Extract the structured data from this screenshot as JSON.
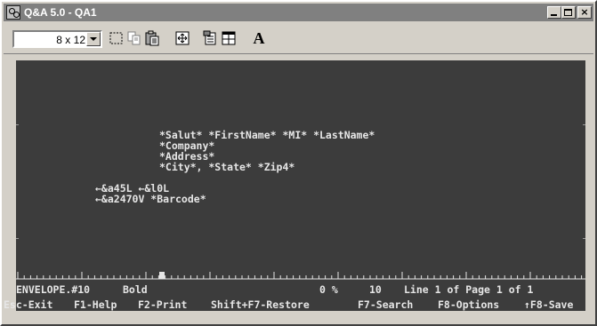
{
  "window": {
    "title": "Q&A 5.0 - QA1",
    "controls": {
      "minimize": "_",
      "maximize": "□",
      "close": "×"
    }
  },
  "toolbar": {
    "font_size_value": "8 x 12",
    "icons": [
      "select-icon",
      "copy-icon",
      "paste-icon",
      "fullscreen-icon",
      "properties-icon",
      "window-icon",
      "font-icon"
    ],
    "font_button_label": "A"
  },
  "document": {
    "lines": [
      "*Salut* *FirstName* *MI* *LastName*",
      "*Company*",
      "*Address*",
      "*City*, *State* *Zip4*",
      "←&a45L ←&l0L",
      "←&a2470V *Barcode*"
    ]
  },
  "status": {
    "filename": "ENVELOPE.#10",
    "style": "Bold",
    "percent": "0 %",
    "column": "10",
    "position": "Line 1 of Page 1 of 1"
  },
  "function_keys": [
    "Esc-Exit",
    "F1-Help",
    "F2-Print",
    "Shift+F7-Restore",
    "F7-Search",
    "F8-Options",
    "↑F8-Save"
  ]
}
